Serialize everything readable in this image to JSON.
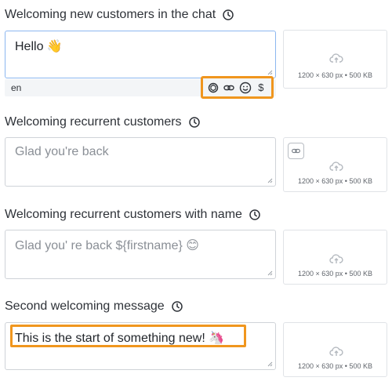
{
  "sections": [
    {
      "title": "Welcoming new customers in the chat",
      "text": "Hello 👋",
      "upload_dims": "1200 × 630 px • 500 KB"
    },
    {
      "title": "Welcoming recurrent customers",
      "text": "Glad you're back",
      "upload_dims": "1200 × 630 px • 500 KB"
    },
    {
      "title": "Welcoming recurrent customers with name",
      "text": "Glad you' re back ${firstname} 😊",
      "upload_dims": "1200 × 630 px • 500 KB"
    },
    {
      "title": "Second welcoming message",
      "text": "This is the start of something new! 🦄",
      "upload_dims": "1200 × 630 px • 500 KB"
    }
  ],
  "language": "en",
  "toolbar": {
    "currency_symbol": "$"
  },
  "colors": {
    "highlight": "#f0961e",
    "focus_border": "#8cb7f0"
  },
  "icons": [
    "clock-icon",
    "upload-cloud-icon",
    "openai-icon",
    "link-icon",
    "emoji-icon",
    "dollar-icon",
    "resize-grip-icon"
  ]
}
